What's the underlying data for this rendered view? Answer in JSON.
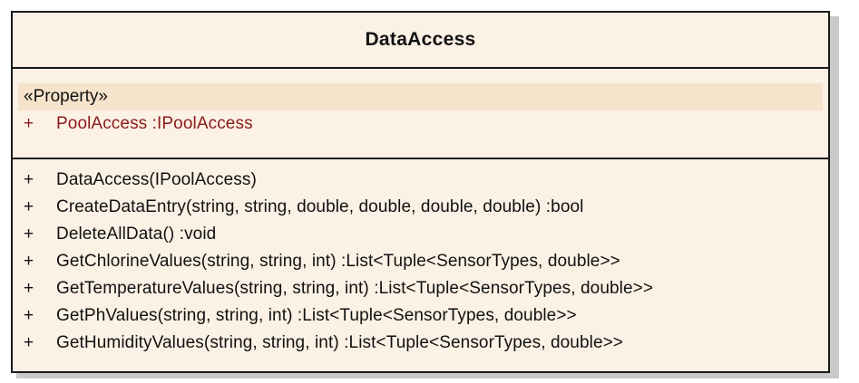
{
  "class": {
    "name": "DataAccess",
    "stereotype": "«Property»",
    "attributes": [
      {
        "visibility": "+",
        "signature": "PoolAccess :IPoolAccess"
      }
    ],
    "operations": [
      {
        "visibility": "+",
        "signature": "DataAccess(IPoolAccess)"
      },
      {
        "visibility": "+",
        "signature": "CreateDataEntry(string, string, double, double, double, double) :bool"
      },
      {
        "visibility": "+",
        "signature": "DeleteAllData() :void"
      },
      {
        "visibility": "+",
        "signature": "GetChlorineValues(string, string, int) :List<Tuple<SensorTypes, double>>"
      },
      {
        "visibility": "+",
        "signature": "GetTemperatureValues(string, string, int) :List<Tuple<SensorTypes, double>>"
      },
      {
        "visibility": "+",
        "signature": "GetPhValues(string, string, int) :List<Tuple<SensorTypes, double>>"
      },
      {
        "visibility": "+",
        "signature": "GetHumidityValues(string, string, int) :List<Tuple<SensorTypes, double>>"
      }
    ]
  },
  "colors": {
    "box_fill": "#fbf1e4",
    "stereotype_fill": "#f5e3cc",
    "border": "#1a1a1a",
    "attribute_text": "#8b1a1a",
    "operation_text": "#111111"
  }
}
